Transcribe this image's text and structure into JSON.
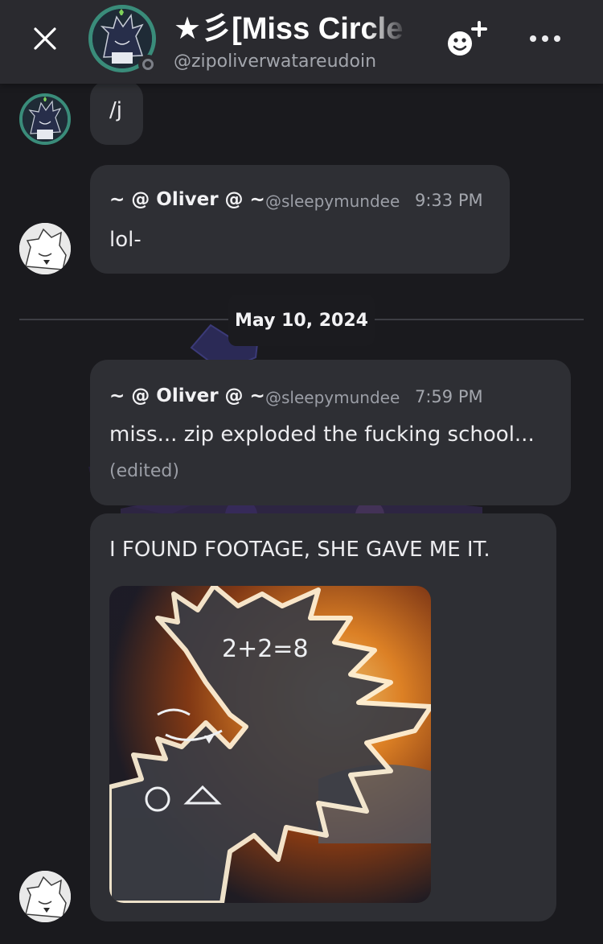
{
  "header": {
    "close_icon": "close-icon",
    "title": "★彡[Miss Circle",
    "handle": "@zipoliverwatareudoin",
    "status": "offline",
    "add_friend_icon": "add-friend-icon",
    "more_icon": "more-options-icon"
  },
  "messages": [
    {
      "id": "m1",
      "avatar": "zip",
      "text": "/j"
    },
    {
      "id": "m2",
      "avatar": "oliver",
      "author": "~ @ Oliver @ ~",
      "username": "@sleepymundee",
      "time": "9:33 PM",
      "text": "lol-"
    },
    {
      "id": "m3",
      "avatar": "none",
      "author": "~ @ Oliver @ ~",
      "username": "@sleepymundee",
      "time": "7:59 PM",
      "text": "miss... zip exploded the fucking school...",
      "edited": "(edited)"
    },
    {
      "id": "m4",
      "avatar": "oliver",
      "text": "I FOUND FOOTAGE, SHE GAVE ME IT.",
      "attachment": {
        "math_text": "2+2=8"
      }
    }
  ],
  "date_divider": "May 10, 2024",
  "colors": {
    "header_bg": "#2a2a2f",
    "screen_bg": "#1a1a1e",
    "bubble_bg": "#2e2f34",
    "avatar_ring": "#3a8c7a"
  }
}
